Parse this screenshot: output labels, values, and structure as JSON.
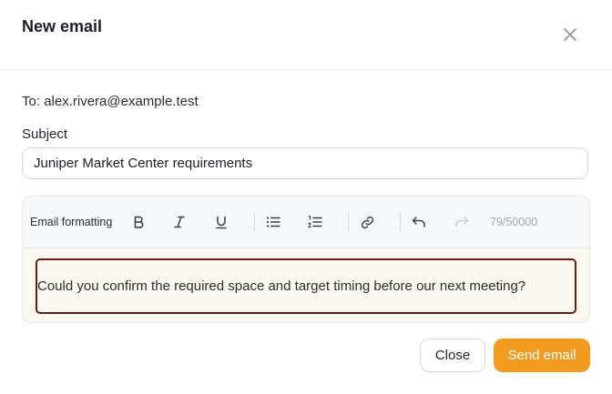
{
  "dialog": {
    "title": "New email",
    "close_icon": "close-icon"
  },
  "recipient": {
    "prefix": "To: ",
    "email": "alex.rivera@example.test"
  },
  "subject": {
    "label": "Subject",
    "value": "Juniper Market Center requirements"
  },
  "editor": {
    "toolbar_label": "Email formatting",
    "tools": [
      "bold-icon",
      "italic-icon",
      "underline-icon",
      "bullet-list-icon",
      "numbered-list-icon",
      "link-icon",
      "undo-icon",
      "redo-icon"
    ],
    "char_count": "79/50000",
    "body": "Could you confirm the required space and target timing before our next meeting?"
  },
  "actions": {
    "close_label": "Close",
    "send_label": "Send email"
  },
  "colors": {
    "accent": "#f39a21",
    "focus_border": "#6b1d12"
  }
}
